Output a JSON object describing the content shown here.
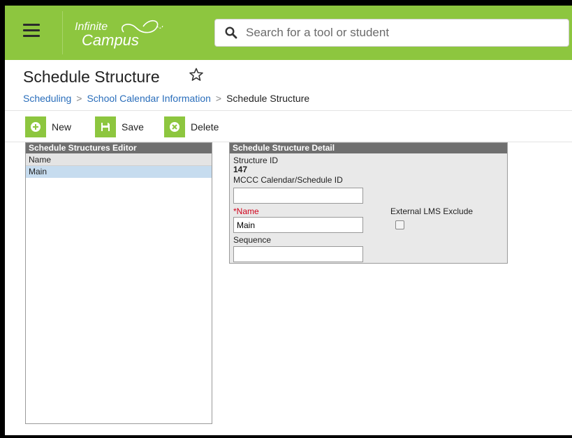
{
  "header": {
    "logo_line1": "Infinite",
    "logo_line2": "Campus",
    "search_placeholder": "Search for a tool or student"
  },
  "page": {
    "title": "Schedule Structure"
  },
  "breadcrumb": {
    "items": [
      "Scheduling",
      "School Calendar Information"
    ],
    "current": "Schedule Structure"
  },
  "toolbar": {
    "new_label": "New",
    "save_label": "Save",
    "delete_label": "Delete"
  },
  "editor": {
    "title": "Schedule Structures Editor",
    "column": "Name",
    "rows": [
      "Main"
    ]
  },
  "detail": {
    "title": "Schedule Structure Detail",
    "structure_id_label": "Structure ID",
    "structure_id_value": "147",
    "mccc_label": "MCCC Calendar/Schedule ID",
    "mccc_value": "",
    "name_label": "*Name",
    "name_value": "Main",
    "external_lms_label": "External LMS Exclude",
    "external_lms_checked": false,
    "sequence_label": "Sequence",
    "sequence_value": ""
  },
  "colors": {
    "brand_green": "#8dc63f",
    "link_blue": "#2a6ebb",
    "required_red": "#d0021b"
  }
}
